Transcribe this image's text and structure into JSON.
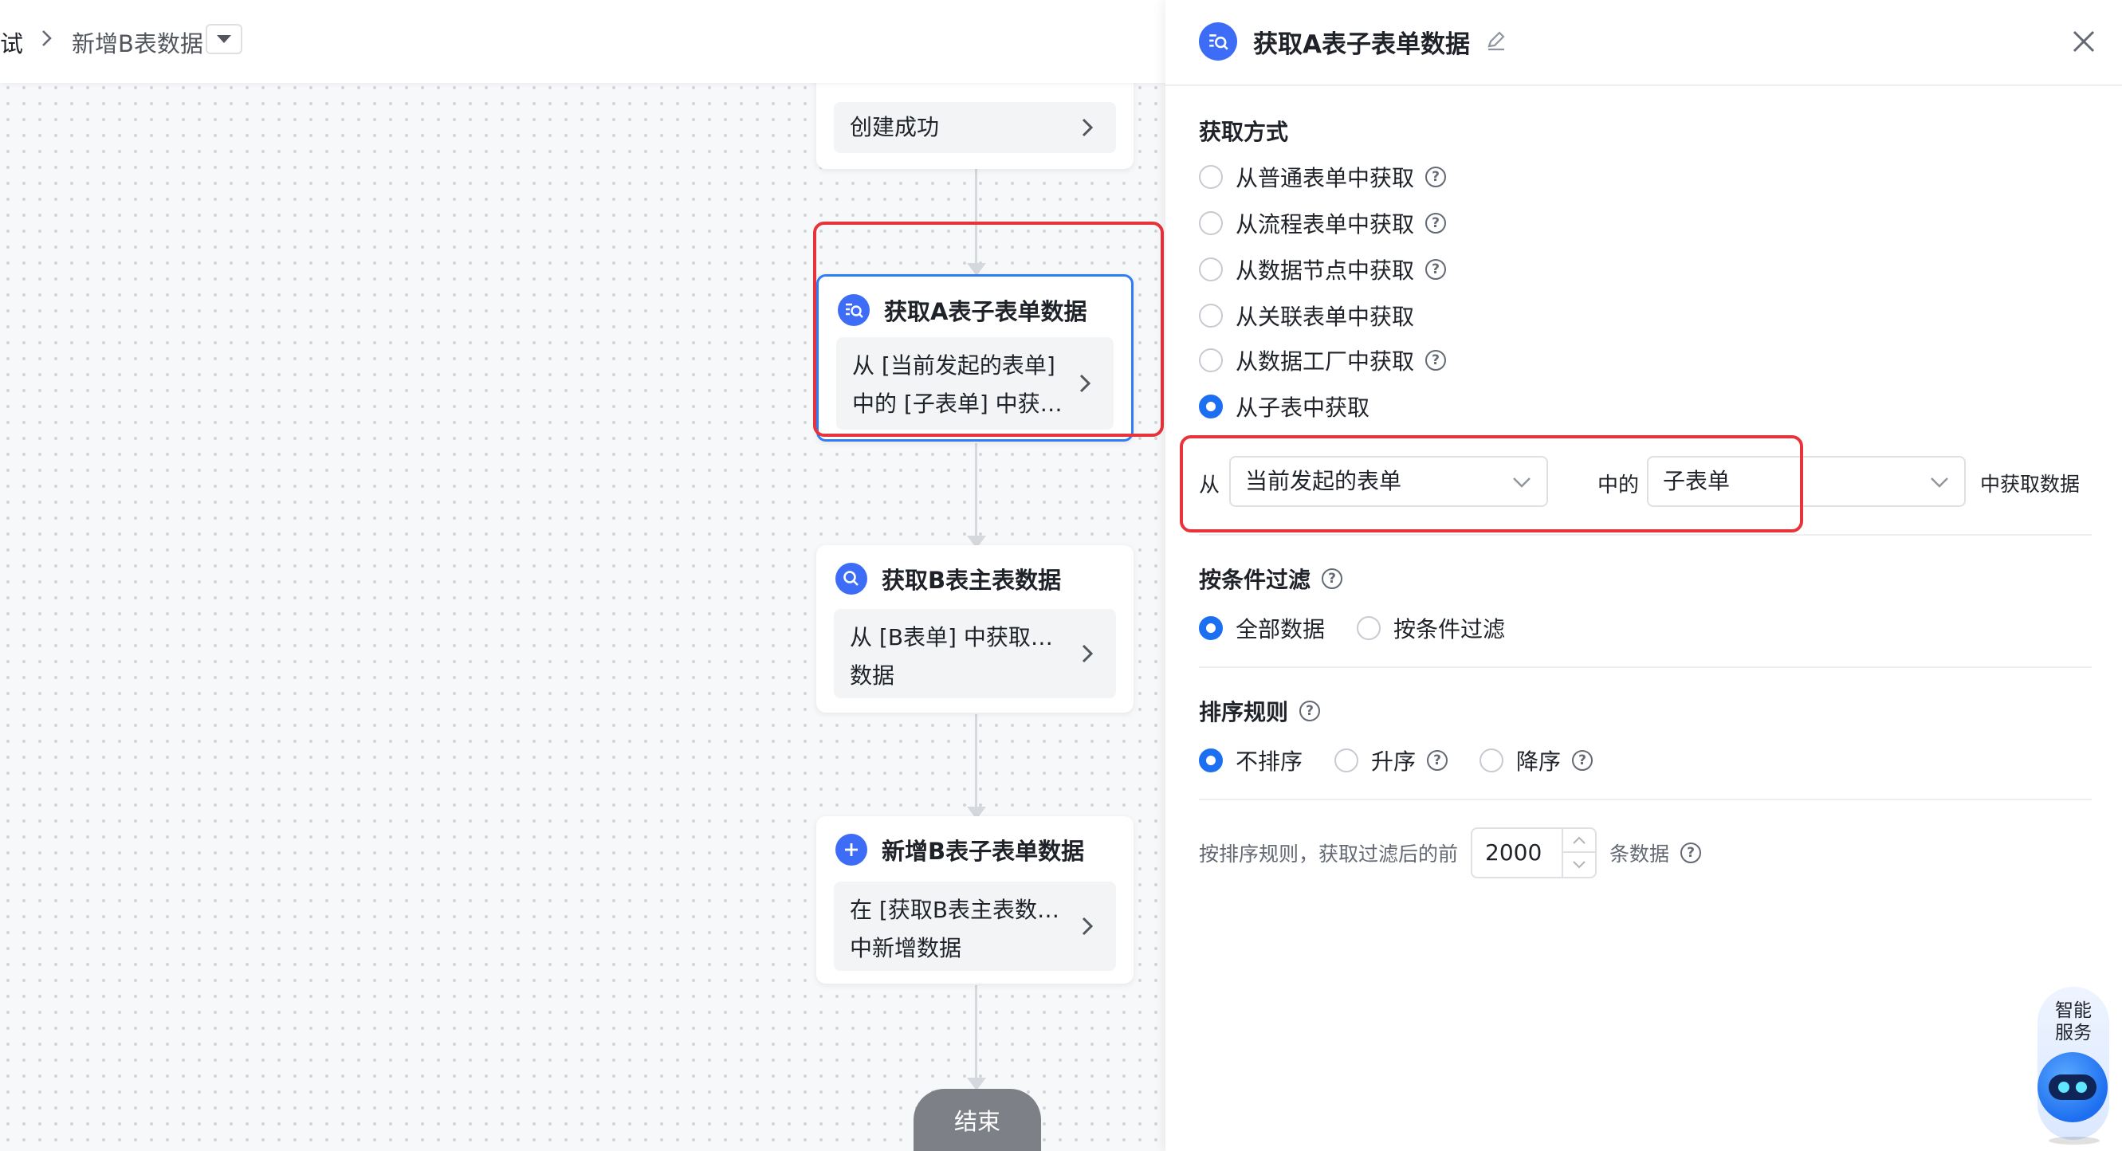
{
  "breadcrumb": {
    "prev": "试",
    "current": "新增B表数据"
  },
  "flow": {
    "nodes": [
      {
        "title": "",
        "body": "创建成功"
      },
      {
        "title": "获取A表子表单数据",
        "body_line1": "从 [当前发起的表单]",
        "body_line2": "中的 [子表单] 中获取数据"
      },
      {
        "title": "获取B表主表数据",
        "body_line1": "从 [B表单] 中获取单条",
        "body_line2": "数据"
      },
      {
        "title": "新增B表子表单数据",
        "body_line1": "在 [获取B表主表数据]",
        "body_line2": "中新增数据"
      }
    ],
    "end_label": "结束"
  },
  "panel": {
    "title": "获取A表子表单数据",
    "fetch_method": {
      "label": "获取方式",
      "options": [
        {
          "label": "从普通表单中获取",
          "help": true,
          "selected": false
        },
        {
          "label": "从流程表单中获取",
          "help": true,
          "selected": false
        },
        {
          "label": "从数据节点中获取",
          "help": true,
          "selected": false
        },
        {
          "label": "从关联表单中获取",
          "help": false,
          "selected": false
        },
        {
          "label": "从数据工厂中获取",
          "help": true,
          "selected": false
        },
        {
          "label": "从子表中获取",
          "help": false,
          "selected": true
        }
      ]
    },
    "source": {
      "from_label": "从",
      "form_select": "当前发起的表单",
      "mid_label": "中的",
      "subform_select": "子表单",
      "end_label": "中获取数据"
    },
    "filter": {
      "label": "按条件过滤",
      "options": [
        {
          "label": "全部数据",
          "selected": true
        },
        {
          "label": "按条件过滤",
          "selected": false
        }
      ]
    },
    "sort": {
      "label": "排序规则",
      "options": [
        {
          "label": "不排序",
          "selected": true
        },
        {
          "label": "升序",
          "selected": false
        },
        {
          "label": "降序",
          "selected": false
        }
      ]
    },
    "limit": {
      "prefix": "按排序规则，获取过滤后的前",
      "value": "2000",
      "suffix": "条数据"
    }
  },
  "assistant": {
    "label": "智能服务"
  },
  "colors": {
    "accent": "#1d6ff2",
    "node_icon": "#3d6df6",
    "highlight": "#e8333a"
  },
  "icons": [
    "chevron-right-icon",
    "caret-down-icon",
    "search-data-icon",
    "search-icon",
    "plus-icon",
    "edit-icon",
    "close-icon",
    "help-icon",
    "chevron-down-icon",
    "robot-icon"
  ]
}
